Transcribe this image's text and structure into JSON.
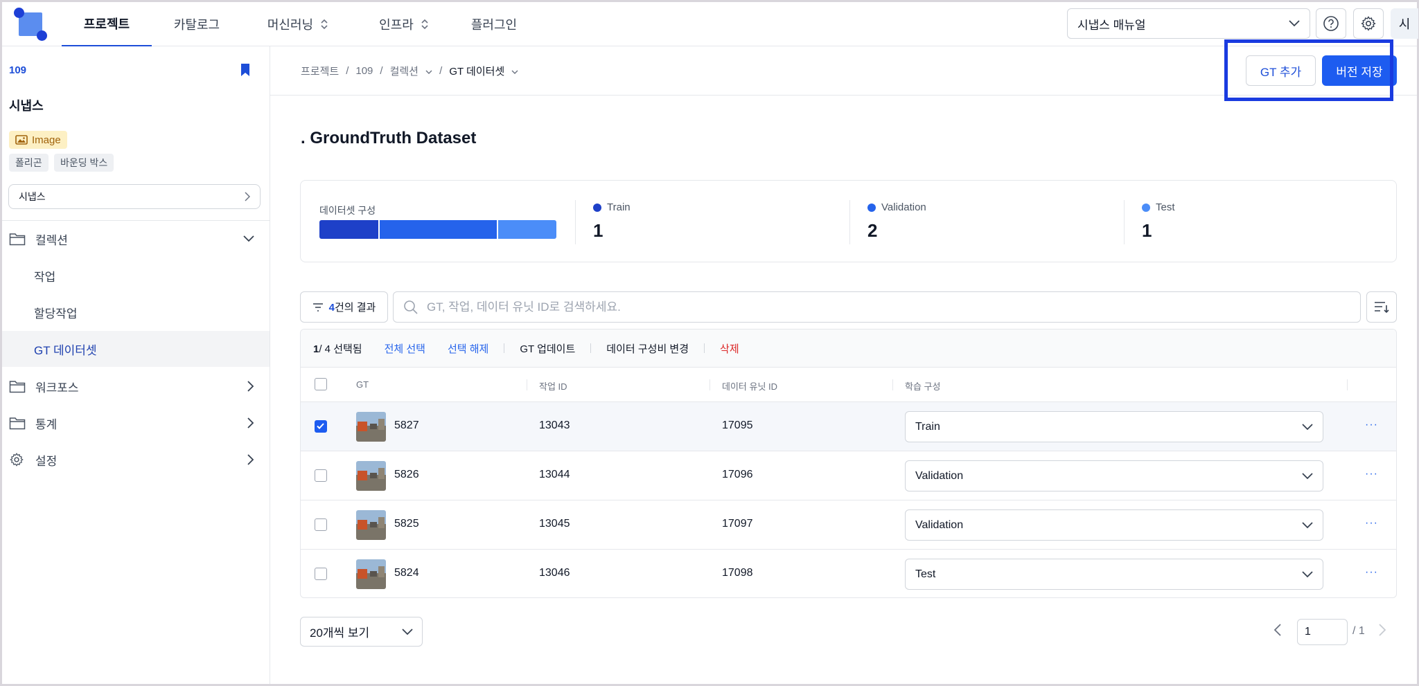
{
  "nav": {
    "tabs": [
      {
        "label": "프로젝트"
      },
      {
        "label": "카탈로그"
      },
      {
        "label": "머신러닝"
      },
      {
        "label": "인프라"
      },
      {
        "label": "플러그인"
      }
    ],
    "manual_select": "시냅스 매뉴얼",
    "avatar": "시"
  },
  "sidebar": {
    "project_id": "109",
    "project_name": "시냅스",
    "data_type_badge": "Image",
    "annotation_chips": [
      "폴리곤",
      "바운딩 박스"
    ],
    "tenant_select": "시냅스",
    "menu": {
      "collection": "컬렉션",
      "sub_items": [
        "작업",
        "할당작업",
        "GT 데이터셋"
      ],
      "workforce": "워크포스",
      "stats": "통계",
      "settings": "설정"
    }
  },
  "breadcrumb": {
    "items": [
      "프로젝트",
      "109",
      "컬렉션",
      "GT 데이터셋"
    ],
    "separator": "/"
  },
  "header_actions": {
    "add_gt": "GT 추가",
    "save_version": "버전 저장"
  },
  "page_title": ". GroundTruth Dataset",
  "composition": {
    "label": "데이터셋 구성",
    "stats": [
      {
        "name": "Train",
        "value": "1",
        "color": "#1e40c8"
      },
      {
        "name": "Validation",
        "value": "2",
        "color": "#2563eb"
      },
      {
        "name": "Test",
        "value": "1",
        "color": "#4b8df8"
      }
    ]
  },
  "filter": {
    "count": "4",
    "suffix": "건의 결과",
    "search_placeholder": "GT, 작업, 데이터 유닛 ID로 검색하세요."
  },
  "selection_bar": {
    "selected": "1",
    "total": "/ 4 선택됨",
    "select_all": "전체 선택",
    "deselect": "선택 해제",
    "gt_update": "GT 업데이트",
    "change_ratio": "데이터 구성비 변경",
    "delete": "삭제"
  },
  "table": {
    "columns": [
      "GT",
      "작업 ID",
      "데이터 유닛 ID",
      "학습 구성"
    ],
    "rows": [
      {
        "gt": "5827",
        "task_id": "13043",
        "unit_id": "17095",
        "split": "Train",
        "checked": true
      },
      {
        "gt": "5826",
        "task_id": "13044",
        "unit_id": "17096",
        "split": "Validation",
        "checked": false
      },
      {
        "gt": "5825",
        "task_id": "13045",
        "unit_id": "17097",
        "split": "Validation",
        "checked": false
      },
      {
        "gt": "5824",
        "task_id": "13046",
        "unit_id": "17098",
        "split": "Test",
        "checked": false
      }
    ]
  },
  "pagination": {
    "page_size": "20개씩 보기",
    "current_page": "1",
    "total_pages": "/ 1"
  },
  "colors": {
    "accent": "#1d5cf0",
    "highlight_box": "#1a3be0"
  }
}
